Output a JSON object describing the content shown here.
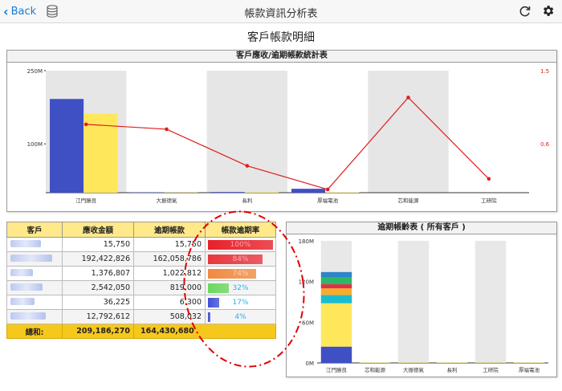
{
  "header": {
    "back_label": "Back",
    "title": "帳款資訊分析表"
  },
  "page_title": "客戶帳款明細",
  "chart_top": {
    "title": "客戶應收/逾期帳款統計表",
    "chart_data": {
      "type": "bar",
      "categories": [
        "江門勝良",
        "大振德氣",
        "長利",
        "厚福電池",
        "芯和能源",
        "工研院"
      ],
      "series": [
        {
          "values": [
            192,
            0.6,
            1.4,
            8,
            0.01,
            0.03
          ],
          "color": "#3f4fc4"
        },
        {
          "values": [
            162,
            0.5,
            1.0,
            0.8,
            0.02,
            0.01
          ],
          "color": "#ffe75c"
        },
        {
          "type": "line",
          "axis": "right",
          "values": [
            0.84,
            0.78,
            0.33,
            0.04,
            1.17,
            0.17
          ],
          "color": "#e11d1d"
        }
      ],
      "ylim": [
        0,
        250
      ],
      "y_ticks": [
        "250M",
        "100M"
      ],
      "y_tick_values": [
        250,
        100
      ],
      "y2lim": [
        0,
        1.5
      ],
      "y2_ticks": [
        "1.5",
        "0.6"
      ],
      "y2_tick_values": [
        1.5,
        0.6
      ]
    }
  },
  "table": {
    "headers": [
      "客戶",
      "應收金額",
      "逾期帳款",
      "帳款逾期率"
    ],
    "rows": [
      {
        "receivable": "15,750",
        "overdue": "15,750",
        "rate": "100%",
        "rate_value": 1.0,
        "color": "#e8202a"
      },
      {
        "receivable": "192,422,826",
        "overdue": "162,058,786",
        "rate": "84%",
        "rate_value": 0.84,
        "color": "#e8363e"
      },
      {
        "receivable": "1,376,807",
        "overdue": "1,022,812",
        "rate": "74%",
        "rate_value": 0.74,
        "color": "#f08a40"
      },
      {
        "receivable": "2,542,050",
        "overdue": "819,000",
        "rate": "32%",
        "rate_value": 0.32,
        "color": "#6ad860"
      },
      {
        "receivable": "36,225",
        "overdue": "6,300",
        "rate": "17%",
        "rate_value": 0.17,
        "color": "#4050d8"
      },
      {
        "receivable": "12,792,612",
        "overdue": "508,032",
        "rate": "4%",
        "rate_value": 0.04,
        "color": "#4050d8"
      }
    ],
    "total": {
      "label": "總和:",
      "receivable": "209,186,270",
      "overdue": "164,430,680"
    }
  },
  "chart_aging": {
    "title": "逾期帳齡表 ( 所有客戶 )",
    "chart_data": {
      "type": "bar",
      "stacked": true,
      "categories": [
        "江門勝良",
        "芯和能源",
        "大振德氣",
        "長利",
        "工研院",
        "厚福電池"
      ],
      "series": [
        {
          "color": "#3f4fc4",
          "values": [
            24,
            0,
            0,
            0,
            0,
            0
          ]
        },
        {
          "color": "#ffe75c",
          "values": [
            64,
            0.5,
            0.5,
            0.5,
            0.5,
            0.5
          ]
        },
        {
          "color": "#1cbcd0",
          "values": [
            12,
            0,
            0,
            0,
            0,
            0
          ]
        },
        {
          "color": "#f7ac2c",
          "values": [
            10,
            0,
            0,
            0,
            0,
            0
          ]
        },
        {
          "color": "#e03048",
          "values": [
            6,
            0,
            0,
            0,
            0,
            0
          ]
        },
        {
          "color": "#2cb866",
          "values": [
            10,
            0,
            0,
            0,
            0,
            0
          ]
        },
        {
          "color": "#2e84c8",
          "values": [
            8,
            0,
            0,
            0,
            0,
            0
          ]
        }
      ],
      "ylim": [
        0,
        180
      ],
      "y_ticks": [
        "180M",
        "120M",
        "60M",
        "0M"
      ],
      "y_tick_values": [
        180,
        120,
        60,
        0
      ]
    }
  },
  "annotation_color": "#e00000"
}
